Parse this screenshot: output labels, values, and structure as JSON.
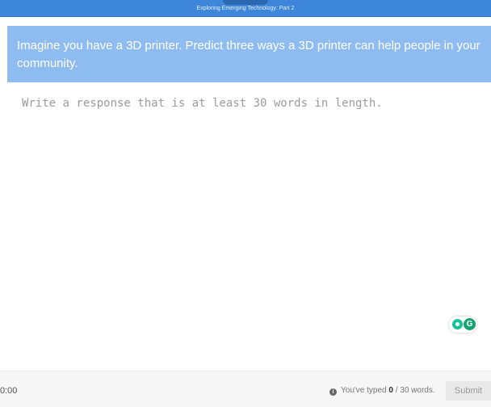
{
  "header": {
    "title": "Exploring Emerging Technology: Part 2",
    "bar_color": "#3d86d9"
  },
  "prompt": {
    "text": "Imagine you have a 3D printer. Predict three ways a 3D printer can help people in your community.",
    "background_color": "#8fbcf0"
  },
  "response": {
    "value": "",
    "placeholder": "Write a response that is at least 30 words in length."
  },
  "extension_badge": {
    "icons": [
      "lightbulb-icon",
      "grammarly-icon"
    ],
    "grammarly_letter": "G"
  },
  "footer": {
    "timer": "0:00",
    "word_count_prefix": "You've typed ",
    "word_count_current": "0",
    "word_count_separator": " / ",
    "word_count_target": "30",
    "word_count_suffix": " words.",
    "submit_label": "Submit"
  }
}
